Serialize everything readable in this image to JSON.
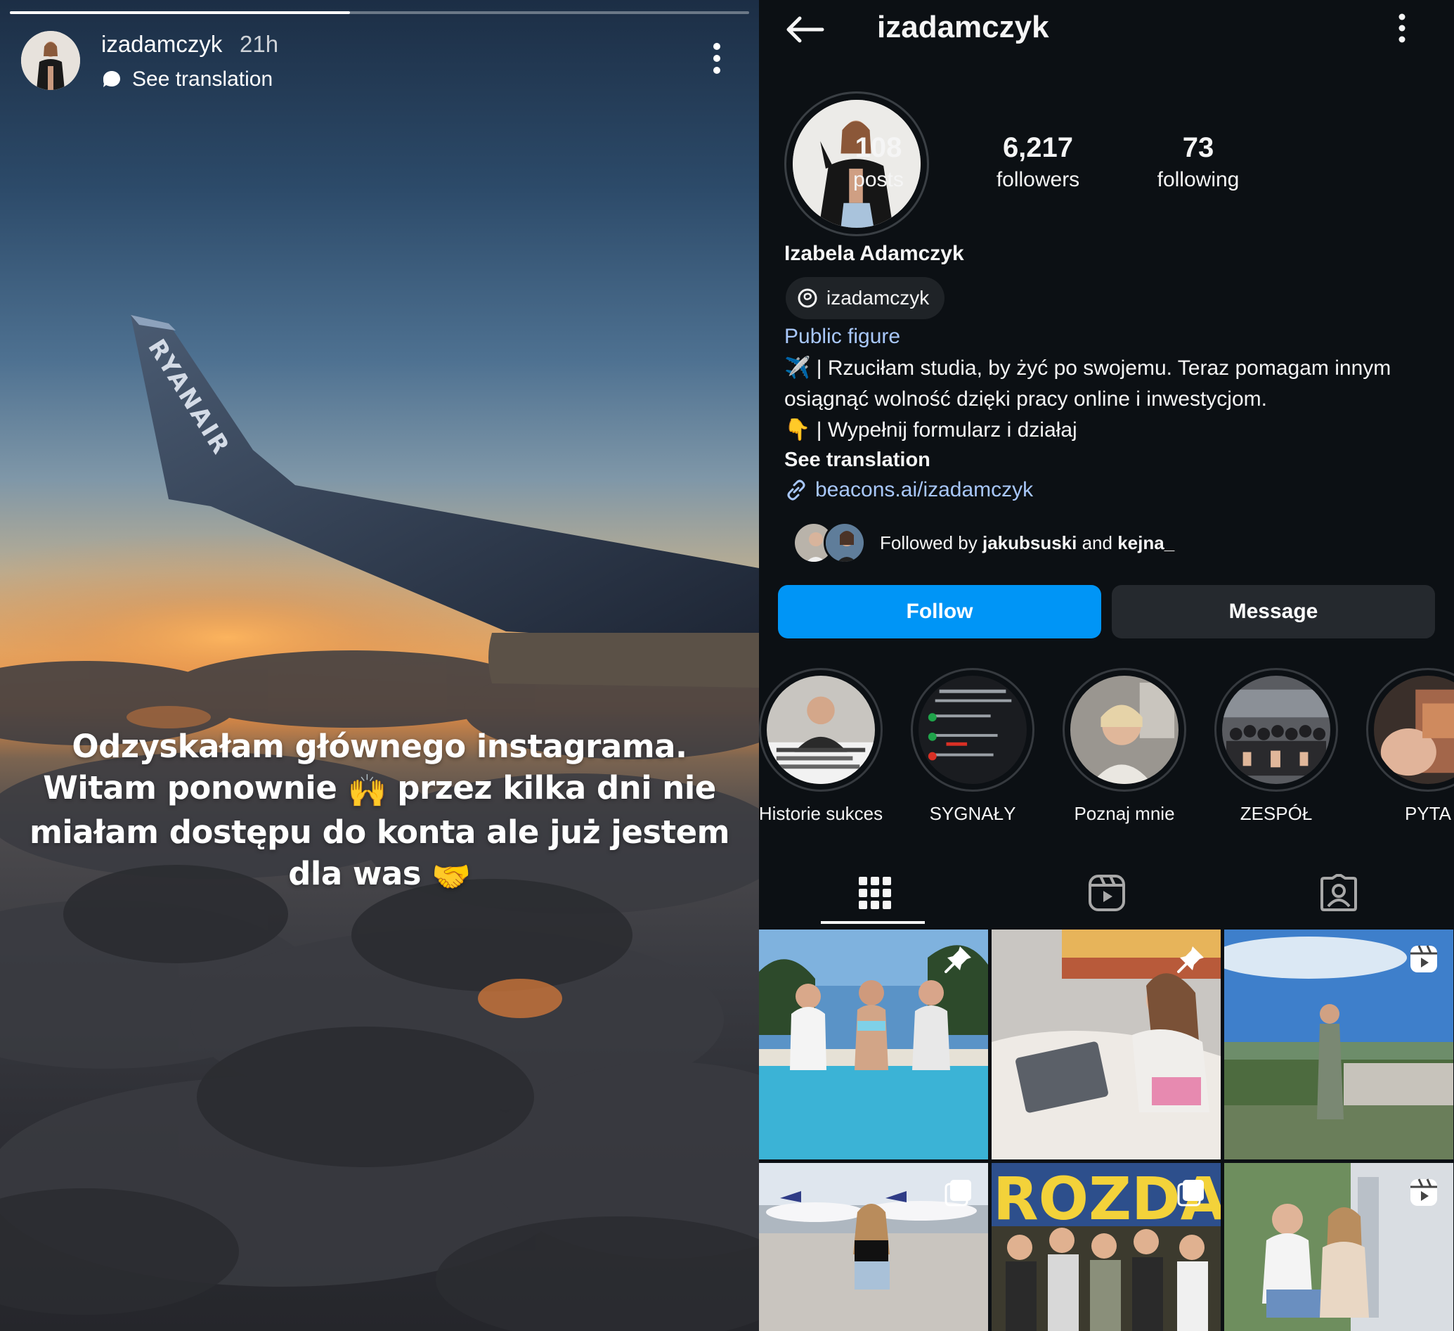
{
  "story": {
    "progress": 0.46,
    "username": "izadamczyk",
    "time": "21h",
    "see_translation": "See translation",
    "wing_text": "RYANAIR",
    "caption": {
      "line1": "Odzyskałam głównego instagrama.",
      "line2a": "Witam ponownie",
      "line2b": "przez kilka dni nie",
      "line3": "miałam dostępu do konta ale już jestem",
      "line4": "dla was",
      "emoji_hands": "🙌",
      "emoji_handshake": "🤝"
    }
  },
  "profile": {
    "title": "izadamczyk",
    "stats": [
      {
        "value": "108",
        "label": "posts"
      },
      {
        "value": "6,217",
        "label": "followers"
      },
      {
        "value": "73",
        "label": "following"
      }
    ],
    "name": "Izabela Adamczyk",
    "threads_handle": "izadamczyk",
    "category": "Public figure",
    "bio": {
      "line1_emoji": "✈️",
      "line1": " | Rzuciłam studia, by żyć po swojemu. Teraz pomagam innym osiągnąć wolność dzięki pracy online i inwestycjom.",
      "line2_emoji": "👇",
      "line2": " | Wypełnij formularz i działaj"
    },
    "see_translation": "See translation",
    "link": "beacons.ai/izadamczyk",
    "followed_by": {
      "prefix": "Followed by ",
      "user1": "jakubsuski",
      "and": " and ",
      "user2": "kejna_"
    },
    "follow_label": "Follow",
    "message_label": "Message",
    "highlights": [
      "Historie sukces",
      "SYGNAŁY",
      "Poznaj mnie",
      "ZESPÓŁ",
      "PYTA"
    ],
    "tabs": [
      "grid-icon",
      "reels-icon",
      "tagged-icon"
    ],
    "posts_badges": [
      "pin-icon",
      "pin-icon",
      "reel-icon",
      "carousel-icon",
      "carousel-icon",
      "reel-icon"
    ],
    "post_text": "ROZDAWA"
  },
  "colors": {
    "background": "#0c1014",
    "follow_blue": "#0095f6",
    "message_gray": "#25292e",
    "link_blue": "#a8c7fa"
  }
}
